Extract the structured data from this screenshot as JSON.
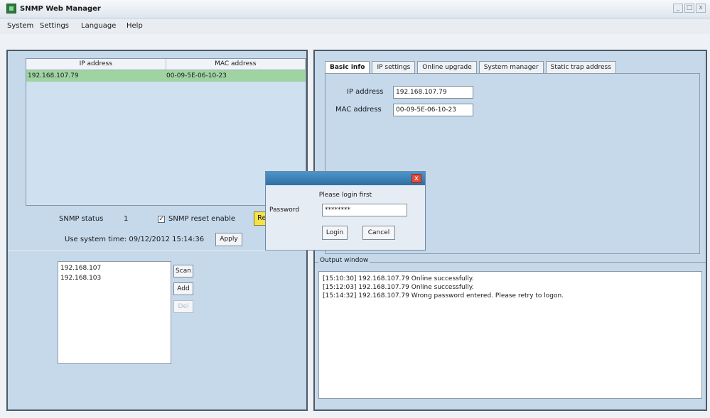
{
  "window": {
    "title": "SNMP Web Manager",
    "controls": [
      "_",
      "□",
      "x"
    ]
  },
  "menu": [
    "System",
    "Settings",
    "Language",
    "Help"
  ],
  "device_table": {
    "headers": [
      "IP address",
      "MAC address"
    ],
    "rows": [
      {
        "ip": "192.168.107.79",
        "mac": "00-09-5E-06-10-23"
      }
    ]
  },
  "snmp": {
    "status_label": "SNMP status",
    "status_value": "1",
    "reset_enable_label": "SNMP reset enable",
    "reset_enable_checked": true,
    "reset_button": "Res",
    "system_time_label": "Use system time:",
    "system_time_value": "09/12/2012 15:14:36",
    "apply_button": "Apply"
  },
  "ip_list": {
    "items": [
      "192.168.107",
      "192.168.103"
    ],
    "scan_button": "Scan",
    "add_button": "Add",
    "del_button": "Del"
  },
  "tabs": [
    "Basic info",
    "IP settings",
    "Online upgrade",
    "System manager",
    "Static trap address"
  ],
  "active_tab": "Basic info",
  "basic_info": {
    "ip_label": "IP address",
    "ip_value": "192.168.107.79",
    "mac_label": "MAC address",
    "mac_value": "00-09-5E-06-10-23"
  },
  "output": {
    "label": "Output window",
    "lines": [
      "[15:10:30]  192.168.107.79 Online successfully.",
      "[15:12:03]  192.168.107.79 Online successfully.",
      "[15:14:32]  192.168.107.79 Wrong password entered. Please retry to logon."
    ]
  },
  "login_dialog": {
    "message": "Please login first",
    "password_label": "Password",
    "password_value": "********",
    "login_button": "Login",
    "cancel_button": "Cancel",
    "close": "x"
  },
  "colors": {
    "panel": "#c5d9eb",
    "selected_row": "#9fd3a2",
    "reset_button": "#f7e14a",
    "dialog_title": "#2f6fa3"
  }
}
